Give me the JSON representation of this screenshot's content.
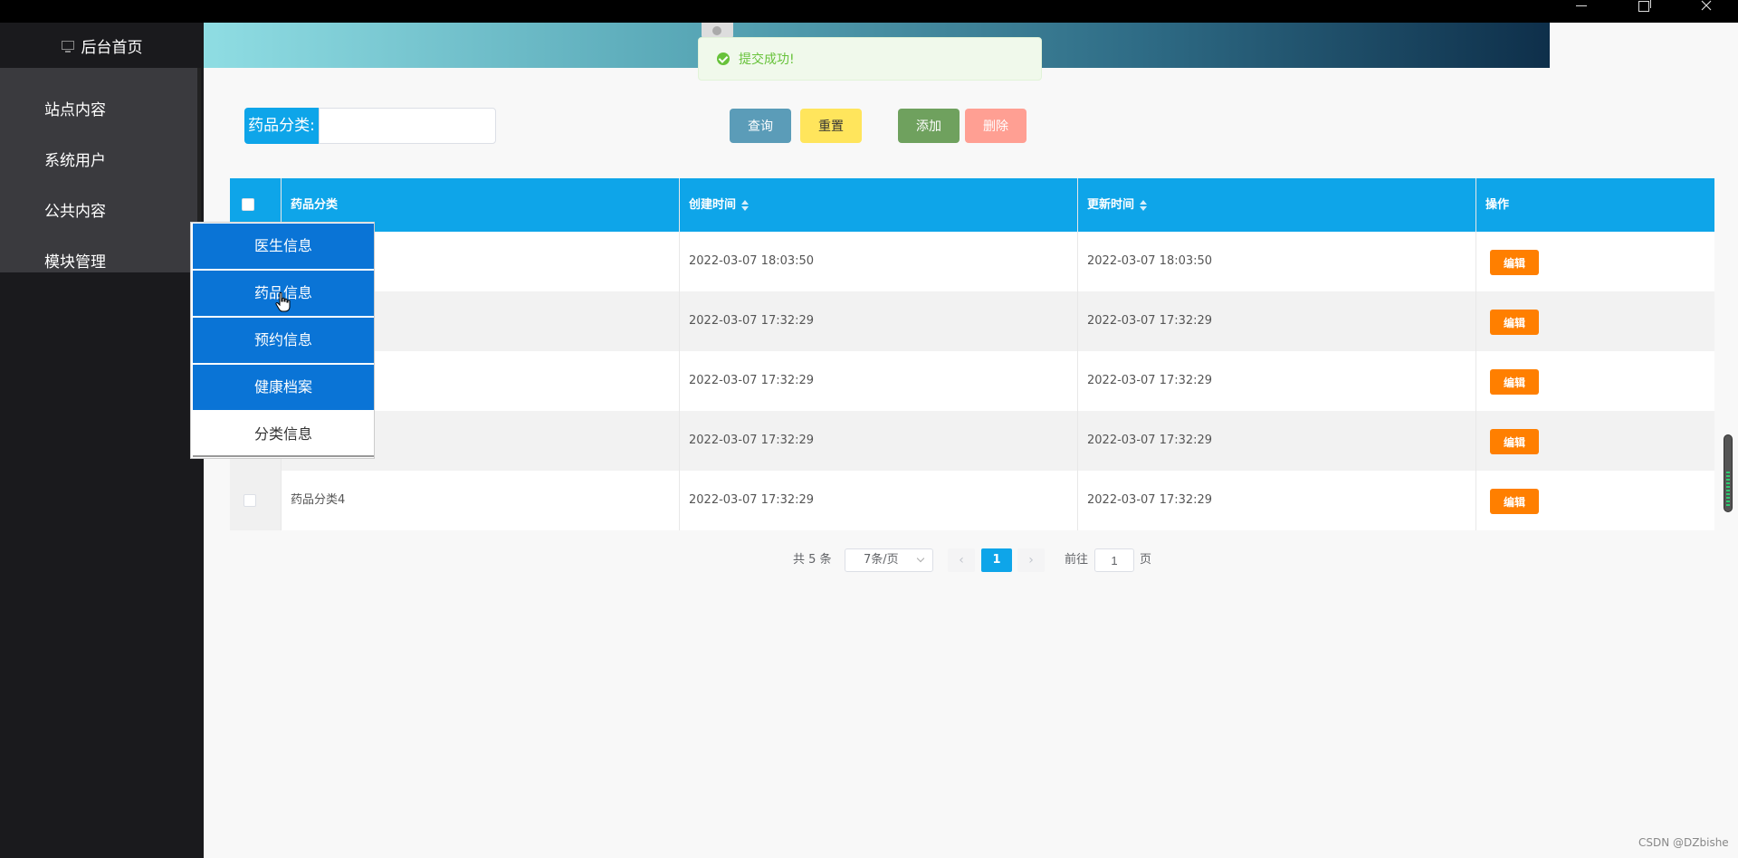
{
  "sidebar": {
    "home_label": "后台首页",
    "items": [
      {
        "label": "站点内容"
      },
      {
        "label": "系统用户"
      },
      {
        "label": "公共内容"
      },
      {
        "label": "模块管理"
      }
    ]
  },
  "toast": {
    "message": "提交成功!"
  },
  "search": {
    "label": "药品分类:",
    "value": ""
  },
  "toolbar": {
    "query_label": "查询",
    "reset_label": "重置",
    "add_label": "添加",
    "delete_label": "删除"
  },
  "table": {
    "columns": [
      "药品分类",
      "创建时间",
      "更新时间",
      "操作"
    ],
    "rows": [
      {
        "category": "",
        "created": "2022-03-07 18:03:50",
        "updated": "2022-03-07 18:03:50",
        "action": "编辑"
      },
      {
        "category": "",
        "created": "2022-03-07 17:32:29",
        "updated": "2022-03-07 17:32:29",
        "action": "编辑"
      },
      {
        "category": "",
        "created": "2022-03-07 17:32:29",
        "updated": "2022-03-07 17:32:29",
        "action": "编辑"
      },
      {
        "category": "",
        "created": "2022-03-07 17:32:29",
        "updated": "2022-03-07 17:32:29",
        "action": "编辑"
      },
      {
        "category": "药品分类4",
        "created": "2022-03-07 17:32:29",
        "updated": "2022-03-07 17:32:29",
        "action": "编辑"
      }
    ]
  },
  "pagination": {
    "total_text": "共 5 条",
    "page_size": "7条/页",
    "prev": "‹",
    "current_page": "1",
    "next": "›",
    "goto_label": "前往",
    "goto_value": "1",
    "goto_unit": "页"
  },
  "submenu": {
    "items": [
      {
        "label": "医生信息"
      },
      {
        "label": "药品信息"
      },
      {
        "label": "预约信息"
      },
      {
        "label": "健康档案"
      },
      {
        "label": "分类信息"
      }
    ]
  },
  "watermark": "CSDN @DZbishe",
  "colors": {
    "primary": "#0ea5e9",
    "sidebar_bg": "#1a1a1d",
    "edit_button": "#ff7f00",
    "submenu_blue": "#0a74d6",
    "success": "#67c23a"
  }
}
